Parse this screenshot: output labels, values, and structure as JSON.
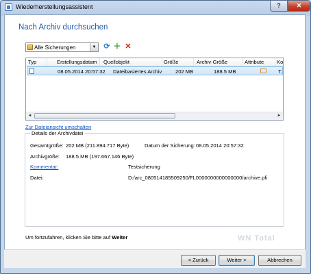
{
  "window": {
    "title": "Wiederherstellungsassistent",
    "help_label": "?",
    "close_label": "✕"
  },
  "page": {
    "heading": "Nach Archiv durchsuchen"
  },
  "toolbar": {
    "filter_value": "Alle Sicherungen",
    "filter_dropdown_glyph": "▼",
    "refresh_glyph": "⟳",
    "add_glyph": "＋",
    "delete_glyph": "✕"
  },
  "table": {
    "columns": [
      "Typ",
      "Erstellungsdatum",
      "Quellobjekt",
      "Größe",
      "Archiv-Größe",
      "Attribute",
      "Ko"
    ],
    "rows": [
      {
        "type_icon": "archive-file-icon",
        "date": "08.05.2014 20:57:32",
        "source": "Dateibasiertes Archiv",
        "size": "202 MB",
        "archive_size": "188.5 MB",
        "attribute_icon": "attribute-icon",
        "comment": "T."
      }
    ],
    "scroll_left": "◄",
    "scroll_right": "►"
  },
  "switch_view_link": "Zur Dateiansicht umschalten",
  "details": {
    "legend": "Details der Archivdatei",
    "total_size_label": "Gesamtgröße:",
    "total_size_value": "202 MB (211.894.717 Byte)",
    "backup_date_label": "Datum der Sicherung:",
    "backup_date_value": "08.05.2014 20:57:32",
    "archive_size_label": "Archivgröße:",
    "archive_size_value": "188.5 MB (197.667.146 Byte)",
    "comment_label": "Kommentar:",
    "comment_value": "Testsicherung",
    "file_label": "Datei:",
    "file_value": "D:/arc_080514185509250/FL0000000000000000/archive.pfi"
  },
  "instruction": {
    "prefix": "Um fortzufahren, klicken Sie bitte auf",
    "emphasis": "Weiter"
  },
  "buttons": {
    "back": "< Zurück",
    "next": "Weiter >",
    "cancel": "Abbrechen"
  },
  "colors": {
    "heading": "#1f5ba8",
    "link": "#0a58c8",
    "selection": "#cfe6f9",
    "close_button": "#c4432c"
  }
}
